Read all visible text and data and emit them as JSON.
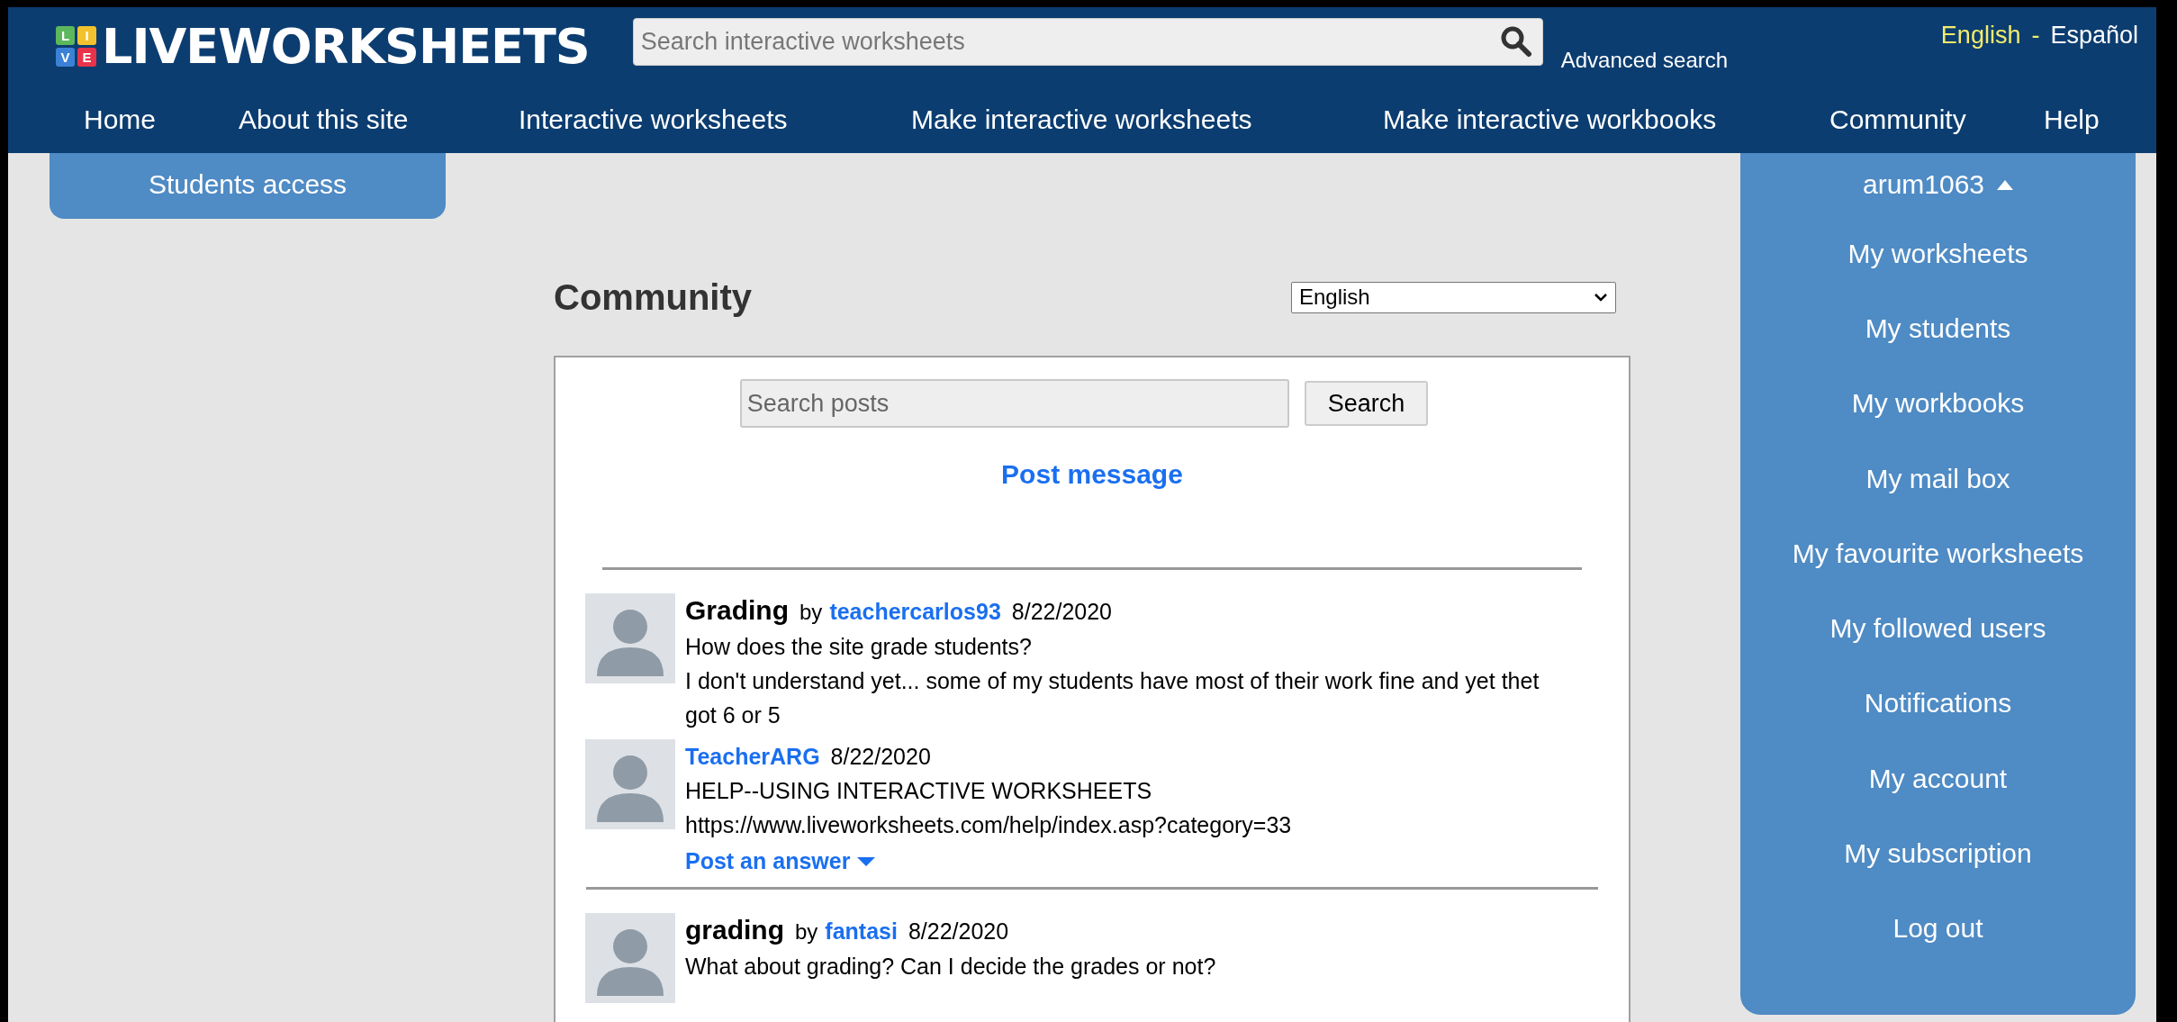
{
  "logo": {
    "tiles": [
      {
        "letter": "L",
        "color": "#5cb85c"
      },
      {
        "letter": "I",
        "color": "#f2c12e"
      },
      {
        "letter": "V",
        "color": "#3b82d6"
      },
      {
        "letter": "E",
        "color": "#e8334a"
      }
    ],
    "wordmark": "LIVEWORKSHEETS"
  },
  "search": {
    "placeholder": "Search interactive worksheets"
  },
  "advanced_search": "Advanced search",
  "languages": [
    {
      "label": "English",
      "selected": true
    },
    {
      "label": "Español",
      "selected": false
    }
  ],
  "language_separator": "-",
  "nav": [
    "Home",
    "About this site",
    "Interactive worksheets",
    "Make interactive worksheets",
    "Make interactive workbooks",
    "Community",
    "Help"
  ],
  "students_access": "Students access",
  "user_menu": {
    "username": "arum1063",
    "expanded": true,
    "items": [
      "My worksheets",
      "My students",
      "My workbooks",
      "My mail box",
      "My favourite worksheets",
      "My followed users",
      "Notifications",
      "My account",
      "My subscription",
      "Log out"
    ]
  },
  "community": {
    "title": "Community",
    "language_select": "English",
    "search": {
      "placeholder": "Search posts",
      "button": "Search"
    },
    "post_message": "Post message",
    "posts": [
      {
        "title": "Grading",
        "by": "by",
        "author": "teachercarlos93",
        "date": "8/22/2020",
        "body": [
          "How does the site grade students?",
          "I don't understand yet... some of my students have most of their work fine and yet thet got 6 or 5"
        ],
        "replies": [
          {
            "author": "TeacherARG",
            "date": "8/22/2020",
            "body": [
              "HELP--USING INTERACTIVE WORKSHEETS",
              "https://www.liveworksheets.com/help/index.asp?category=33"
            ]
          }
        ],
        "post_answer": "Post an answer"
      },
      {
        "title": "grading",
        "by": "by",
        "author": "fantasi",
        "date": "8/22/2020",
        "body": [
          "What about grading? Can I decide the grades or not?"
        ]
      }
    ]
  }
}
